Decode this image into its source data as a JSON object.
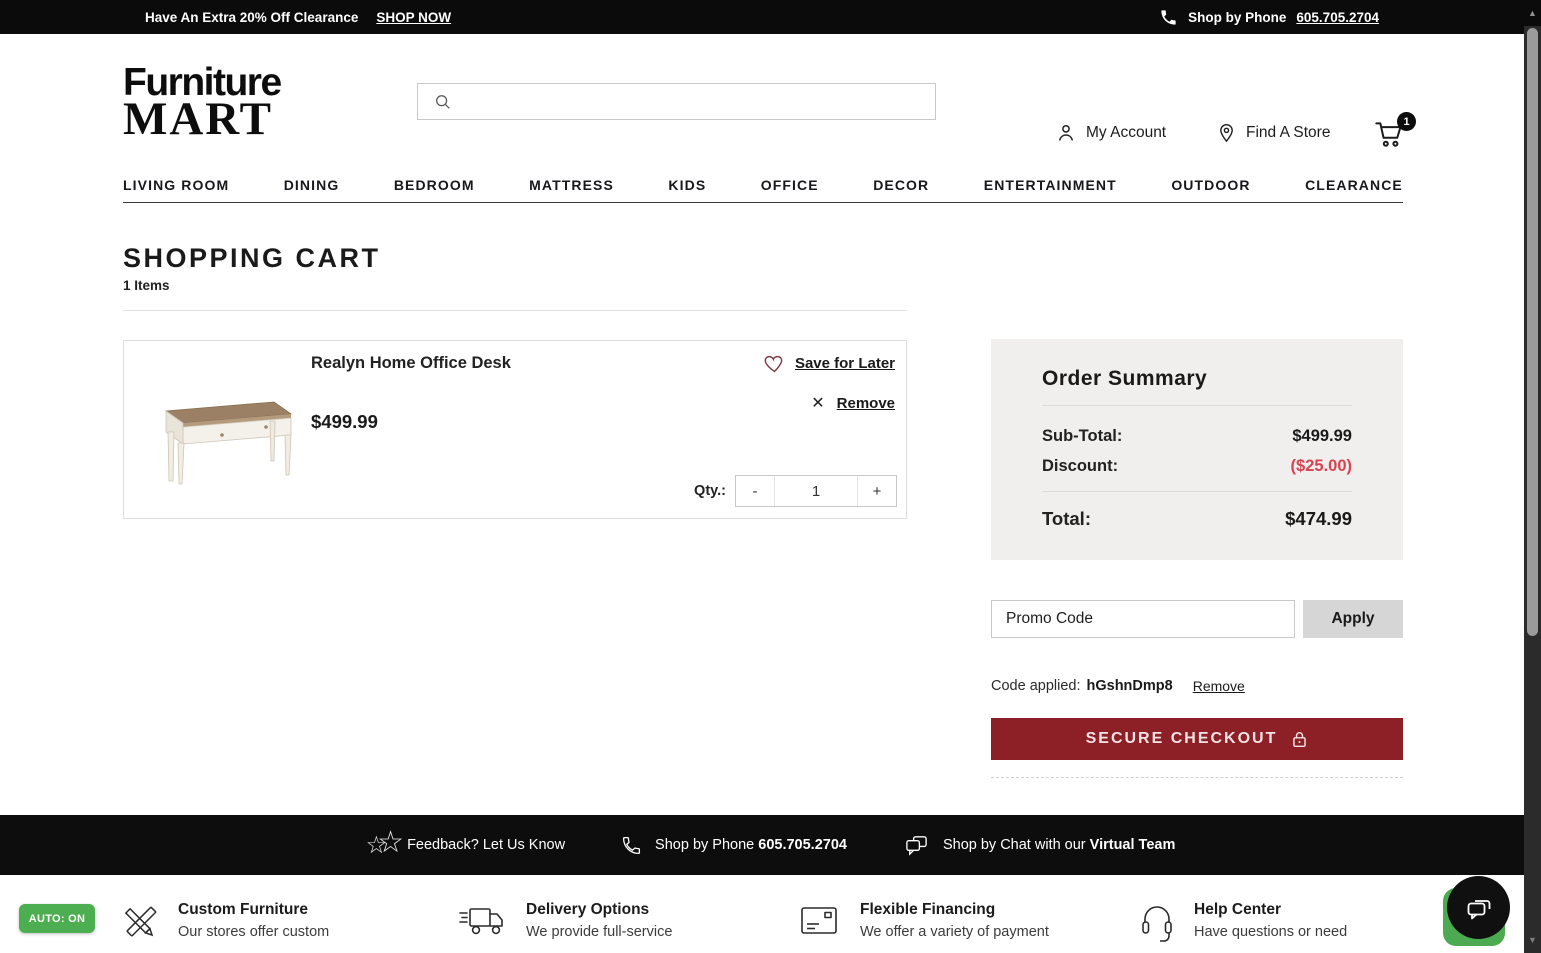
{
  "colors": {
    "topbar_bg": "#0b0b0b",
    "accent_maroon": "#8c2026",
    "discount_red": "#d84351",
    "summary_bg": "#f0efee",
    "apply_button_bg": "#d6d6d6",
    "badge_green": "#4cae50",
    "heart_maroon": "#7d3b45"
  },
  "topbar": {
    "promo_message": "Have An Extra 20% Off Clearance",
    "promo_cta": "SHOP NOW",
    "phone_label": "Shop by Phone",
    "phone_number": "605.705.2704"
  },
  "header": {
    "logo_line1": "Furniture",
    "logo_line2": "MART",
    "account_label": "My Account",
    "find_store_label": "Find A Store",
    "cart_count": "1"
  },
  "nav": {
    "items": [
      "LIVING ROOM",
      "DINING",
      "BEDROOM",
      "MATTRESS",
      "KIDS",
      "OFFICE",
      "DECOR",
      "ENTERTAINMENT",
      "OUTDOOR",
      "CLEARANCE"
    ]
  },
  "cart": {
    "page_title": "SHOPPING CART",
    "item_count": "1 Items",
    "item": {
      "name": "Realyn Home Office Desk",
      "price": "$499.99",
      "save_for_later_label": "Save for Later",
      "remove_x": "✕",
      "remove_label": "Remove",
      "qty_label": "Qty.:",
      "qty_value": "1",
      "qty_decrease": "-",
      "qty_increase": "+"
    }
  },
  "order_summary": {
    "title": "Order Summary",
    "subtotal_label": "Sub-Total:",
    "subtotal_value": "$499.99",
    "discount_label": "Discount:",
    "discount_value": "($25.00)",
    "total_label": "Total:",
    "total_value": "$474.99"
  },
  "promo": {
    "input_placeholder": "Promo Code",
    "apply_label": "Apply",
    "applied_label": "Code applied:",
    "applied_code": "hGshnDmp8",
    "remove_label": "Remove"
  },
  "checkout": {
    "label": "SECURE CHECKOUT"
  },
  "footer_bar": {
    "feedback_label": "Feedback? Let Us Know",
    "phone_prefix": "Shop by Phone",
    "phone_number": "605.705.2704",
    "chat_prefix": "Shop by Chat with our",
    "chat_bold": "Virtual Team"
  },
  "features": [
    {
      "title": "Custom Furniture",
      "desc": "Our stores offer custom"
    },
    {
      "title": "Delivery Options",
      "desc": "We provide full-service"
    },
    {
      "title": "Flexible Financing",
      "desc": "We offer a variety of payment"
    },
    {
      "title": "Help Center",
      "desc": "Have questions or need"
    }
  ],
  "auto_badge": {
    "label": "AUTO: ON"
  }
}
